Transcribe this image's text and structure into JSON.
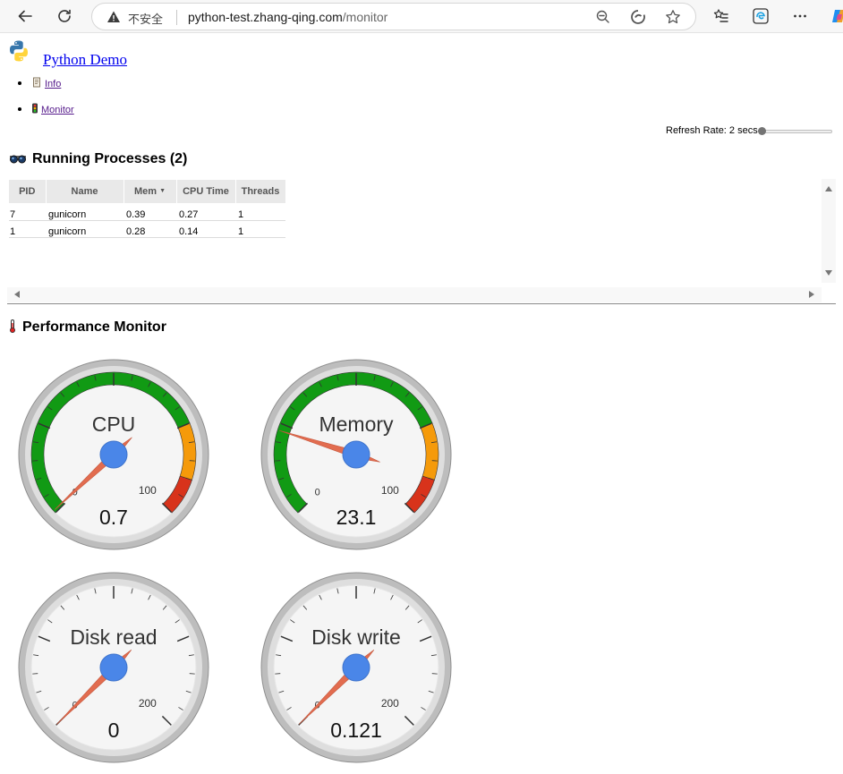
{
  "browser": {
    "security_label": "不安全",
    "url_host": "python-test.zhang-qing.com",
    "url_path": "/monitor"
  },
  "brand": {
    "title": "Python Demo"
  },
  "nav": [
    {
      "label": "Info",
      "icon": "scroll-icon"
    },
    {
      "label": "Monitor",
      "icon": "traffic-light-icon"
    }
  ],
  "refresh": {
    "label": "Refresh Rate: 2 secs",
    "value": 0
  },
  "processes": {
    "title": "Running Processes (2)",
    "icon": "goggles-icon",
    "columns": [
      "PID",
      "Name",
      "Mem",
      "CPU Time",
      "Threads"
    ],
    "sort_column": "Mem",
    "rows": [
      [
        "7",
        "gunicorn",
        "0.39",
        "0.27",
        "1"
      ],
      [
        "1",
        "gunicorn",
        "0.28",
        "0.14",
        "1"
      ]
    ]
  },
  "performance": {
    "title": "Performance Monitor",
    "icon": "thermometer-icon",
    "gauges": [
      {
        "label": "CPU",
        "value_text": "0.7",
        "value": 0.7,
        "max": 100,
        "min_label": "0",
        "max_label": "100",
        "zones": true
      },
      {
        "label": "Memory",
        "value_text": "23.1",
        "value": 23.1,
        "max": 100,
        "min_label": "0",
        "max_label": "100",
        "zones": true
      },
      {
        "label": "Disk read",
        "value_text": "0",
        "value": 0,
        "max": 200,
        "min_label": "0",
        "max_label": "200",
        "zones": false
      },
      {
        "label": "Disk write",
        "value_text": "0.121",
        "value": 0.121,
        "max": 200,
        "min_label": "0",
        "max_label": "200",
        "zones": false
      }
    ]
  },
  "colors": {
    "green_zone": "#119a14",
    "orange_zone": "#f59a0a",
    "red_zone": "#d8331b",
    "needle": "#e26c4f",
    "hub": "#4a86e8"
  }
}
